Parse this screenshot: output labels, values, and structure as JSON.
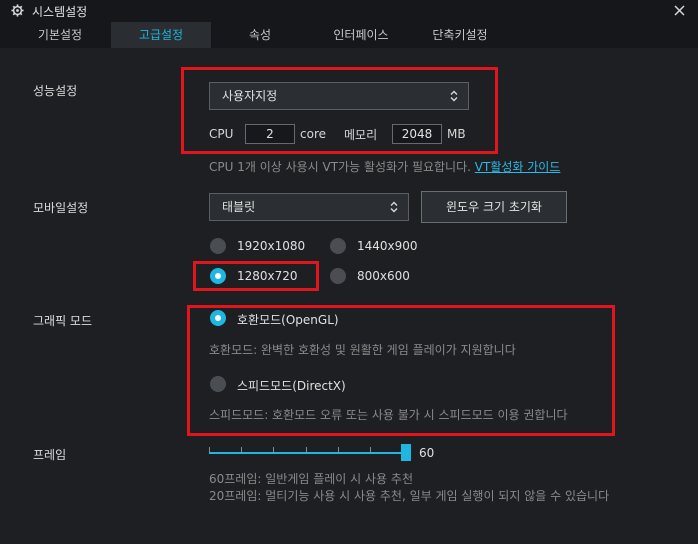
{
  "window": {
    "title": "시스템설정",
    "gear_icon": "gear-icon",
    "close_icon": "close-icon"
  },
  "tabs": [
    {
      "label": "기본설정",
      "active": false
    },
    {
      "label": "고급설정",
      "active": true
    },
    {
      "label": "속성",
      "active": false
    },
    {
      "label": "인터페이스",
      "active": false
    },
    {
      "label": "단축키설정",
      "active": false
    }
  ],
  "performance": {
    "label": "성능설정",
    "mode_value": "사용자지정",
    "cpu_label": "CPU",
    "cpu_value": "2",
    "cpu_unit": "core",
    "memory_label": "메모리",
    "memory_value": "2048",
    "memory_unit": "MB",
    "hint": "CPU 1개 이상 사용시 VT가능 활성화가 필요합니다. ",
    "vt_link": "VT활성화 가이드"
  },
  "mobile": {
    "label": "모바일설정",
    "device_value": "태블릿",
    "reset_button": "윈도우 크기 초기화",
    "resolutions": [
      {
        "label": "1920x1080",
        "selected": false
      },
      {
        "label": "1440x900",
        "selected": false
      },
      {
        "label": "1280x720",
        "selected": true
      },
      {
        "label": "800x600",
        "selected": false
      }
    ]
  },
  "graphics": {
    "label": "그래픽 모드",
    "compat_label": "호환모드(OpenGL)",
    "compat_selected": true,
    "compat_desc": "호환모드: 완벽한 호환성 및 원활한 게임 플레이가 지원합니다",
    "speed_label": "스피드모드(DirectX)",
    "speed_selected": false,
    "speed_desc": "스피드모드: 호환모드 오류 또는 사용 불가 시 스피드모드 이용 권합니다"
  },
  "frame": {
    "label": "프레임",
    "value": "60",
    "slider_fraction": 1.0,
    "hint1": "60프레임: 일반게임 플레이 시 사용 추천",
    "hint2": "20프레임: 멀티기능 사용 시 사용 추천, 일부 게임 실행이 되지 않을 수 있습니다"
  },
  "colors": {
    "accent": "#1fb7e2",
    "highlight": "#e0161c",
    "background": "#1d1f22"
  }
}
